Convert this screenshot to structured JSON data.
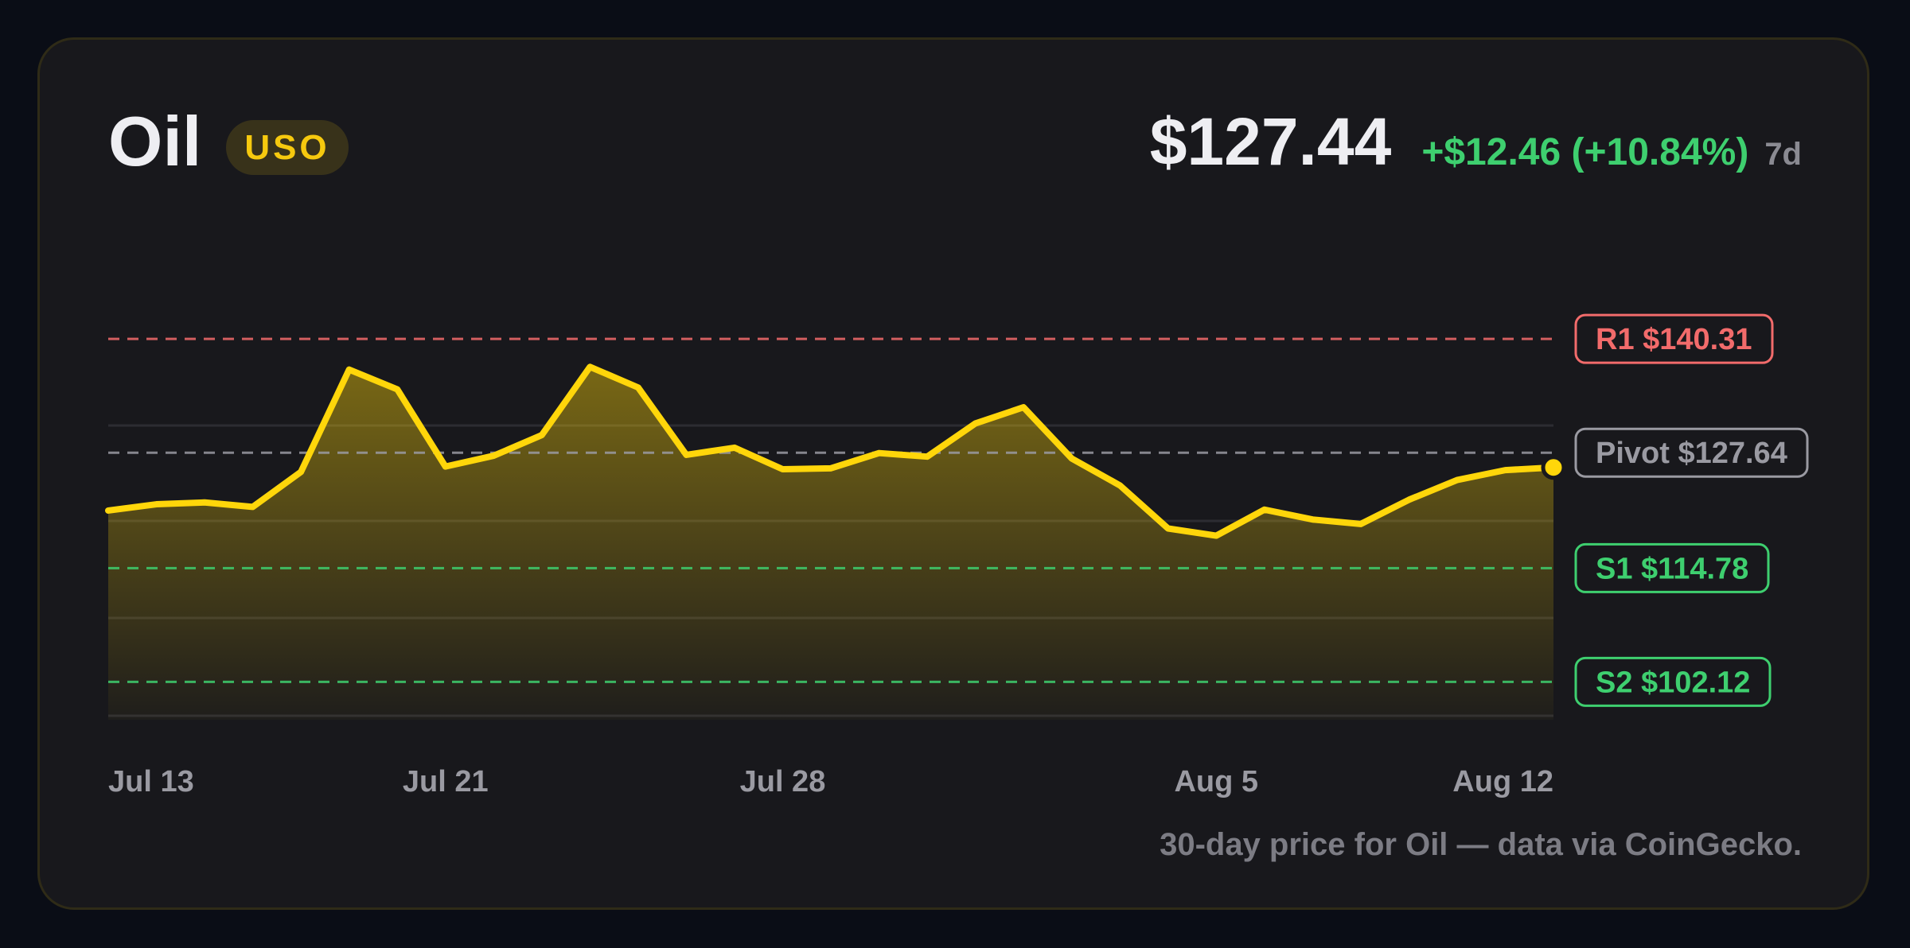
{
  "header": {
    "asset_name": "Oil",
    "ticker": "USO",
    "price": "$127.44",
    "change": "+$12.46 (+10.84%)",
    "period": "7d"
  },
  "caption": "30-day price for Oil — data via CoinGecko.",
  "colors": {
    "line": "#ffd60a",
    "resistance": "#f26b6b",
    "pivot": "#9a9aa2",
    "support": "#3ecf6f",
    "change_positive": "#3ecf6f"
  },
  "chart_data": {
    "type": "area",
    "title": "",
    "xlabel": "",
    "ylabel": "",
    "x_tick_labels": [
      {
        "label": "Jul 13",
        "index": 0
      },
      {
        "label": "Jul 21",
        "index": 7
      },
      {
        "label": "Jul 28",
        "index": 14
      },
      {
        "label": "Aug 5",
        "index": 23
      },
      {
        "label": "Aug 12",
        "index": 30
      }
    ],
    "ylim": [
      97.9,
      144.4
    ],
    "grid": true,
    "series": [
      {
        "values": [
          121.2,
          121.9,
          122.1,
          121.6,
          125.5,
          136.9,
          134.7,
          126.1,
          127.3,
          129.6,
          137.2,
          134.9,
          127.4,
          128.2,
          125.8,
          125.9,
          127.6,
          127.2,
          130.9,
          132.7,
          127.0,
          124.0,
          119.2,
          118.4,
          121.3,
          120.2,
          119.7,
          122.4,
          124.6,
          125.7,
          126.0
        ]
      }
    ],
    "levels": [
      {
        "label": "R1 $140.31",
        "value": 140.31,
        "kind": "resistance"
      },
      {
        "label": "Pivot $127.64",
        "value": 127.64,
        "kind": "pivot"
      },
      {
        "label": "S1 $114.78",
        "value": 114.78,
        "kind": "support"
      },
      {
        "label": "S2 $102.12",
        "value": 102.12,
        "kind": "support"
      }
    ],
    "last_point_marker": true
  }
}
